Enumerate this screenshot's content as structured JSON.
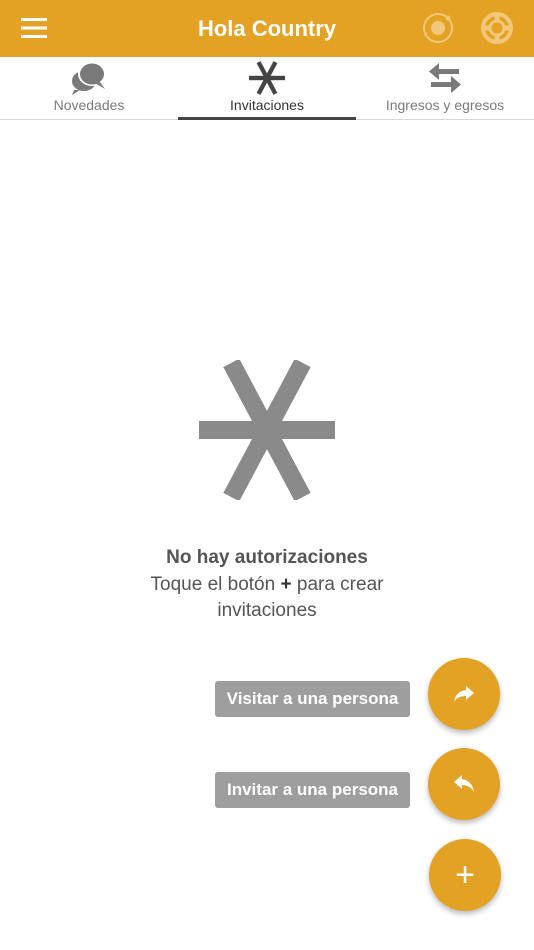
{
  "appbar": {
    "title": "Hola Country",
    "color": "#E3A224",
    "menu_icon": "menu-icon",
    "actions": [
      {
        "icon": "record-icon"
      },
      {
        "icon": "lifebuoy-icon"
      }
    ]
  },
  "tabs": [
    {
      "label": "Novedades",
      "icon": "chat-bubbles-icon",
      "active": false
    },
    {
      "label": "Invitaciones",
      "icon": "asterisk-icon",
      "active": true
    },
    {
      "label": "Ingresos y egresos",
      "icon": "swap-arrows-icon",
      "active": false
    }
  ],
  "empty_state": {
    "icon": "asterisk-icon",
    "title": "No hay autorizaciones",
    "subtitle_before": "Toque el botón ",
    "subtitle_symbol": "+",
    "subtitle_after": " para crear invitaciones"
  },
  "fab_menu": {
    "visit_label": "Visitar a una persona",
    "visit_icon": "share-forward-icon",
    "invite_label": "Invitar a una persona",
    "invite_icon": "reply-icon",
    "main_symbol": "+",
    "main_icon": "plus-icon"
  }
}
